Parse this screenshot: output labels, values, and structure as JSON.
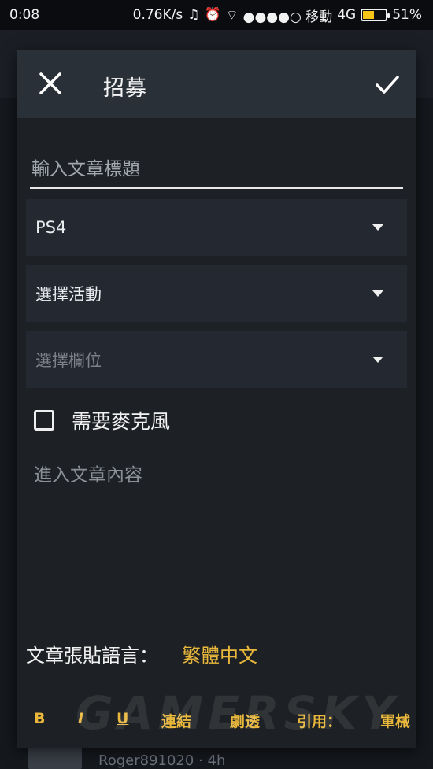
{
  "status_bar": {
    "time": "0:08",
    "net_speed": "0.76K/s",
    "carrier": "●●●●○ 移動",
    "network": "4G",
    "battery": "51%",
    "battery_level": 0.51
  },
  "dialog": {
    "title": "招募",
    "title_placeholder": "輸入文章標題",
    "platform_value": "PS4",
    "activity_value": "選擇活動",
    "slot_value": "選擇欄位",
    "mic_label": "需要麥克風",
    "mic_checked": false,
    "content_placeholder": "進入文章內容",
    "language_label": "文章張貼語言：",
    "language_value": "繁體中文"
  },
  "toolbar": {
    "bold": "B",
    "italic": "I",
    "underline": "U",
    "link": "連結",
    "spoiler": "劇透",
    "quote": "引用：",
    "mecha": "軍械"
  },
  "background": {
    "username": "Roger891020 · 4h"
  },
  "watermark": "GAMERSKY",
  "colors": {
    "accent": "#e8b73b",
    "header": "#2a3038",
    "dialog": "#1d2024"
  }
}
